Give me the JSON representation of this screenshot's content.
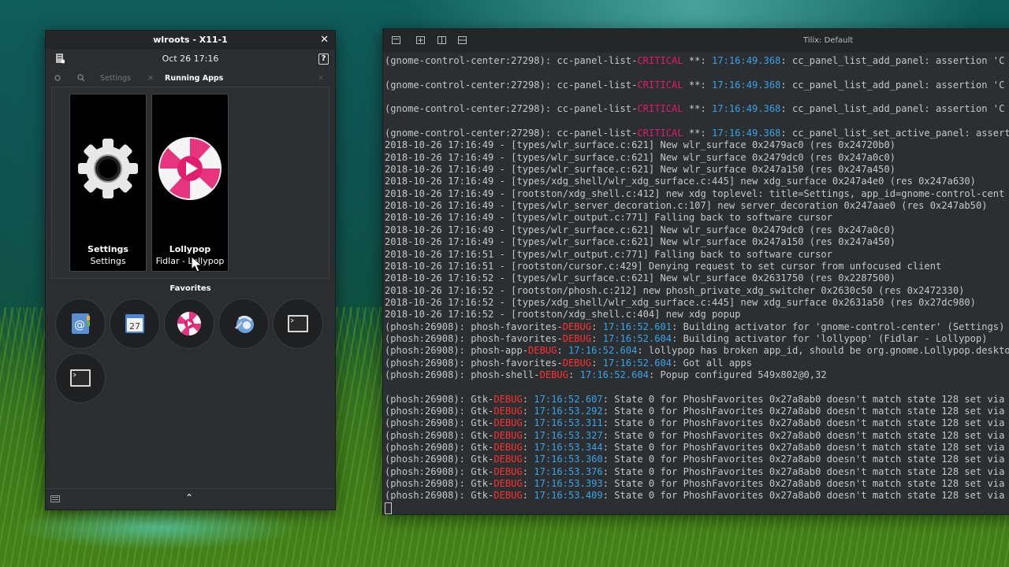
{
  "phosh_window": {
    "title": "wlroots - X11-1",
    "clock": "Oct 26  17:16",
    "help": "?",
    "tabs": [
      {
        "label": "Settings",
        "active": false
      },
      {
        "label": "Running Apps",
        "active": true
      }
    ],
    "running_apps": [
      {
        "name": "Settings",
        "subtitle": "Settings",
        "icon": "gear-icon"
      },
      {
        "name": "Lollypop",
        "subtitle": "Fidlar - Lollypop",
        "icon": "lollypop-icon"
      }
    ],
    "favorites_title": "Favorites",
    "favorites": [
      {
        "icon": "contacts-icon"
      },
      {
        "icon": "calendar-icon",
        "text": "27"
      },
      {
        "icon": "lollypop-icon"
      },
      {
        "icon": "web-browser-icon"
      },
      {
        "icon": "terminal-icon"
      },
      {
        "icon": "terminal-icon"
      }
    ]
  },
  "terminal": {
    "title": "Tilix: Default",
    "lines": [
      [
        [
          "(gnome-control-center:27298): cc-panel-list-",
          ""
        ],
        [
          "CRITICAL",
          "crit"
        ],
        [
          " **: ",
          ""
        ],
        [
          "17:16:49.368",
          "ts"
        ],
        [
          ": cc_panel_list_add_panel: assertion 'C",
          ""
        ]
      ],
      [],
      [
        [
          "(gnome-control-center:27298): cc-panel-list-",
          ""
        ],
        [
          "CRITICAL",
          "crit"
        ],
        [
          " **: ",
          ""
        ],
        [
          "17:16:49.368",
          "ts"
        ],
        [
          ": cc_panel_list_add_panel: assertion 'C",
          ""
        ]
      ],
      [],
      [
        [
          "(gnome-control-center:27298): cc-panel-list-",
          ""
        ],
        [
          "CRITICAL",
          "crit"
        ],
        [
          " **: ",
          ""
        ],
        [
          "17:16:49.368",
          "ts"
        ],
        [
          ": cc_panel_list_add_panel: assertion 'C",
          ""
        ]
      ],
      [],
      [
        [
          "(gnome-control-center:27298): cc-panel-list-",
          ""
        ],
        [
          "CRITICAL",
          "crit"
        ],
        [
          " **: ",
          ""
        ],
        [
          "17:16:49.368",
          "ts"
        ],
        [
          ": cc_panel_list_set_active_panel: assert",
          ""
        ]
      ],
      [
        [
          "2018-10-26 17:16:49 - [types/wlr_surface.c:621] New wlr_surface 0x2479ac0 (res 0x24720b0)",
          ""
        ]
      ],
      [
        [
          "2018-10-26 17:16:49 - [types/wlr_surface.c:621] New wlr_surface 0x2479dc0 (res 0x247a0c0)",
          ""
        ]
      ],
      [
        [
          "2018-10-26 17:16:49 - [types/wlr_surface.c:621] New wlr_surface 0x247a150 (res 0x247a450)",
          ""
        ]
      ],
      [
        [
          "2018-10-26 17:16:49 - [types/xdg_shell/wlr_xdg_surface.c:445] new xdg_surface 0x247a4e0 (res 0x247a630)",
          ""
        ]
      ],
      [
        [
          "2018-10-26 17:16:49 - [rootston/xdg_shell.c:412] new xdg toplevel: title=Settings, app_id=gnome-control-cent",
          ""
        ]
      ],
      [
        [
          "2018-10-26 17:16:49 - [types/wlr_server_decoration.c:107] new server_decoration 0x247aae0 (res 0x247ab50)",
          ""
        ]
      ],
      [
        [
          "2018-10-26 17:16:49 - [types/wlr_output.c:771] Falling back to software cursor",
          ""
        ]
      ],
      [
        [
          "2018-10-26 17:16:49 - [types/wlr_surface.c:621] New wlr_surface 0x2479dc0 (res 0x247a0c0)",
          ""
        ]
      ],
      [
        [
          "2018-10-26 17:16:49 - [types/wlr_surface.c:621] New wlr_surface 0x247a150 (res 0x247a450)",
          ""
        ]
      ],
      [
        [
          "2018-10-26 17:16:51 - [types/wlr_output.c:771] Falling back to software cursor",
          ""
        ]
      ],
      [
        [
          "2018-10-26 17:16:51 - [rootston/cursor.c:429] Denying request to set cursor from unfocused client",
          ""
        ]
      ],
      [
        [
          "2018-10-26 17:16:52 - [types/wlr_surface.c:621] New wlr_surface 0x2631750 (res 0x2287500)",
          ""
        ]
      ],
      [
        [
          "2018-10-26 17:16:52 - [rootston/phosh.c:212] new phosh_private_xdg_switcher 0x2630c50 (res 0x2472330)",
          ""
        ]
      ],
      [
        [
          "2018-10-26 17:16:52 - [types/xdg_shell/wlr_xdg_surface.c:445] new xdg_surface 0x2631a50 (res 0x27dc980)",
          ""
        ]
      ],
      [
        [
          "2018-10-26 17:16:52 - [rootston/xdg_shell.c:404] new xdg popup",
          ""
        ]
      ],
      [
        [
          "(phosh:26908): phosh-favorites-",
          ""
        ],
        [
          "DEBUG",
          "dbg"
        ],
        [
          ": ",
          ""
        ],
        [
          "17:16:52.601",
          "ts"
        ],
        [
          ": Building activator for 'gnome-control-center' (Settings)",
          ""
        ]
      ],
      [
        [
          "(phosh:26908): phosh-favorites-",
          ""
        ],
        [
          "DEBUG",
          "dbg"
        ],
        [
          ": ",
          ""
        ],
        [
          "17:16:52.604",
          "ts"
        ],
        [
          ": Building activator for 'lollypop' (Fidlar - Lollypop)",
          ""
        ]
      ],
      [
        [
          "(phosh:26908): phosh-app-",
          ""
        ],
        [
          "DEBUG",
          "dbg"
        ],
        [
          ": ",
          ""
        ],
        [
          "17:16:52.604",
          "ts"
        ],
        [
          ": lollypop has broken app_id, should be org.gnome.Lollypop.deskto",
          ""
        ]
      ],
      [
        [
          "(phosh:26908): phosh-favorites-",
          ""
        ],
        [
          "DEBUG",
          "dbg"
        ],
        [
          ": ",
          ""
        ],
        [
          "17:16:52.604",
          "ts"
        ],
        [
          ": Got all apps",
          ""
        ]
      ],
      [
        [
          "(phosh:26908): phosh-shell-",
          ""
        ],
        [
          "DEBUG",
          "dbg"
        ],
        [
          ": ",
          ""
        ],
        [
          "17:16:52.604",
          "ts"
        ],
        [
          ": Popup configured 549x802@0,32",
          ""
        ]
      ],
      [],
      [
        [
          "(phosh:26908): Gtk-",
          ""
        ],
        [
          "DEBUG",
          "dbg"
        ],
        [
          ": ",
          ""
        ],
        [
          "17:16:52.607",
          "ts"
        ],
        [
          ": State 0 for PhoshFavorites 0x27a8ab0 doesn't match state 128 set via",
          ""
        ]
      ],
      [
        [
          "(phosh:26908): Gtk-",
          ""
        ],
        [
          "DEBUG",
          "dbg"
        ],
        [
          ": ",
          ""
        ],
        [
          "17:16:53.292",
          "ts"
        ],
        [
          ": State 0 for PhoshFavorites 0x27a8ab0 doesn't match state 128 set via",
          ""
        ]
      ],
      [
        [
          "(phosh:26908): Gtk-",
          ""
        ],
        [
          "DEBUG",
          "dbg"
        ],
        [
          ": ",
          ""
        ],
        [
          "17:16:53.311",
          "ts"
        ],
        [
          ": State 0 for PhoshFavorites 0x27a8ab0 doesn't match state 128 set via",
          ""
        ]
      ],
      [
        [
          "(phosh:26908): Gtk-",
          ""
        ],
        [
          "DEBUG",
          "dbg"
        ],
        [
          ": ",
          ""
        ],
        [
          "17:16:53.327",
          "ts"
        ],
        [
          ": State 0 for PhoshFavorites 0x27a8ab0 doesn't match state 128 set via",
          ""
        ]
      ],
      [
        [
          "(phosh:26908): Gtk-",
          ""
        ],
        [
          "DEBUG",
          "dbg"
        ],
        [
          ": ",
          ""
        ],
        [
          "17:16:53.344",
          "ts"
        ],
        [
          ": State 0 for PhoshFavorites 0x27a8ab0 doesn't match state 128 set via",
          ""
        ]
      ],
      [
        [
          "(phosh:26908): Gtk-",
          ""
        ],
        [
          "DEBUG",
          "dbg"
        ],
        [
          ": ",
          ""
        ],
        [
          "17:16:53.360",
          "ts"
        ],
        [
          ": State 0 for PhoshFavorites 0x27a8ab0 doesn't match state 128 set via",
          ""
        ]
      ],
      [
        [
          "(phosh:26908): Gtk-",
          ""
        ],
        [
          "DEBUG",
          "dbg"
        ],
        [
          ": ",
          ""
        ],
        [
          "17:16:53.376",
          "ts"
        ],
        [
          ": State 0 for PhoshFavorites 0x27a8ab0 doesn't match state 128 set via",
          ""
        ]
      ],
      [
        [
          "(phosh:26908): Gtk-",
          ""
        ],
        [
          "DEBUG",
          "dbg"
        ],
        [
          ": ",
          ""
        ],
        [
          "17:16:53.393",
          "ts"
        ],
        [
          ": State 0 for PhoshFavorites 0x27a8ab0 doesn't match state 128 set via",
          ""
        ]
      ],
      [
        [
          "(phosh:26908): Gtk-",
          ""
        ],
        [
          "DEBUG",
          "dbg"
        ],
        [
          ": ",
          ""
        ],
        [
          "17:16:53.409",
          "ts"
        ],
        [
          ": State 0 for PhoshFavorites 0x27a8ab0 doesn't match state 128 set via",
          ""
        ]
      ]
    ]
  }
}
